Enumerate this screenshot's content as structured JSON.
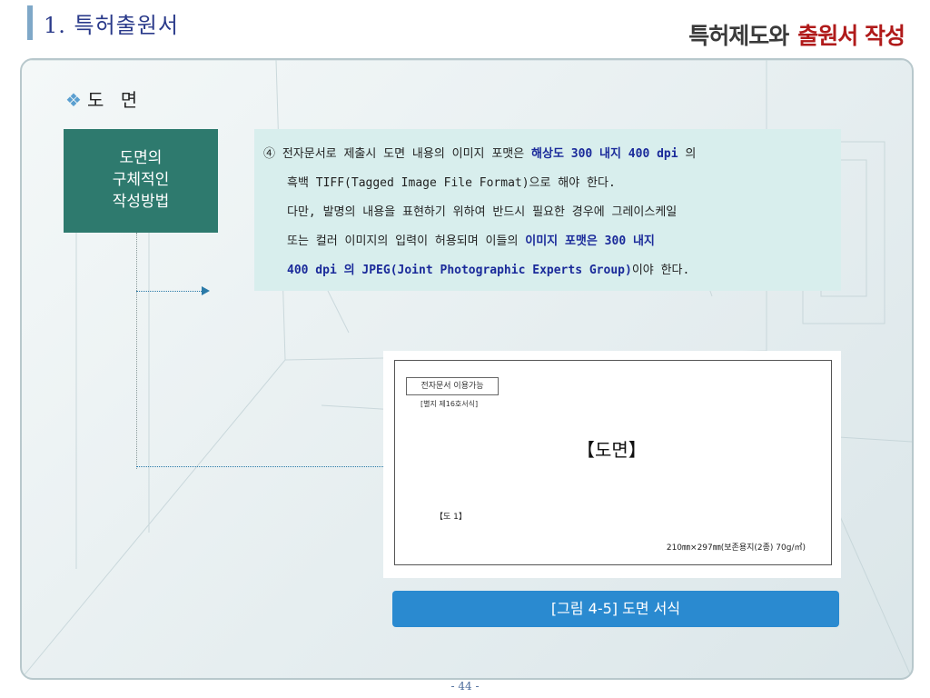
{
  "header": {
    "title": "1. 특허출원서",
    "right_part1": "특허제도와",
    "right_part2": "출원서 작성"
  },
  "section": {
    "bullet_icon": "diamond-cluster-icon",
    "title": "도 면"
  },
  "method_box": {
    "lines": [
      "도면의",
      "구체적인",
      "작성방법"
    ]
  },
  "description": {
    "line1_prefix": "④ 전자문서로 제출시 도면 내용의 이미지 포맷은 ",
    "line1_highlight": "해상도 300 내지 400 dpi",
    "line1_suffix": " 의",
    "line2": "흑백 TIFF(Tagged Image File Format)으로 해야 한다.",
    "line3": "다만, 발명의 내용을 표현하기 위하여 반드시 필요한 경우에 그레이스케일",
    "line4_prefix": "또는 컬러 이미지의 입력이 허용되며 이들의 ",
    "line4_highlight": "이미지 포맷은 300 내지",
    "line5_highlight": "400 dpi 의 JPEG(Joint Photographic Experts Group)",
    "line5_suffix": "이야 한다."
  },
  "figure": {
    "tag": "전자문서 이용가능",
    "form_number": "[별지 제16호서식]",
    "title": "【도면】",
    "ref": "【도 1】",
    "size": "210㎜×297㎜(보존용지(2종) 70g/㎡)"
  },
  "caption": "[그림 4-5] 도면 서식",
  "page_number": "- 44 -",
  "colors": {
    "accent_teal": "#2e7a6e",
    "caption_blue": "#2a8ad0",
    "highlight_navy": "#1a2a9a",
    "header_red": "#b01a1a"
  }
}
